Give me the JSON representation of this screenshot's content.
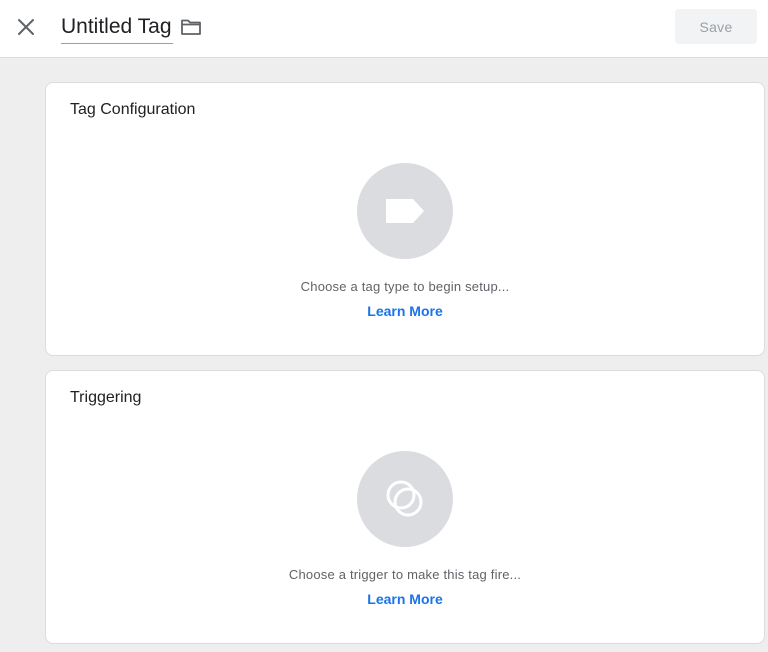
{
  "header": {
    "title": "Untitled Tag",
    "save_label": "Save",
    "close_icon": "close-icon",
    "folder_icon": "folder-icon"
  },
  "cards": [
    {
      "title": "Tag Configuration",
      "icon": "tag-icon",
      "hint": "Choose a tag type to begin setup...",
      "link": "Learn More"
    },
    {
      "title": "Triggering",
      "icon": "trigger-icon",
      "hint": "Choose a trigger to make this tag fire...",
      "link": "Learn More"
    }
  ],
  "colors": {
    "accent": "#1a73e8",
    "background": "#eeeeee",
    "placeholder": "#dadce0"
  }
}
